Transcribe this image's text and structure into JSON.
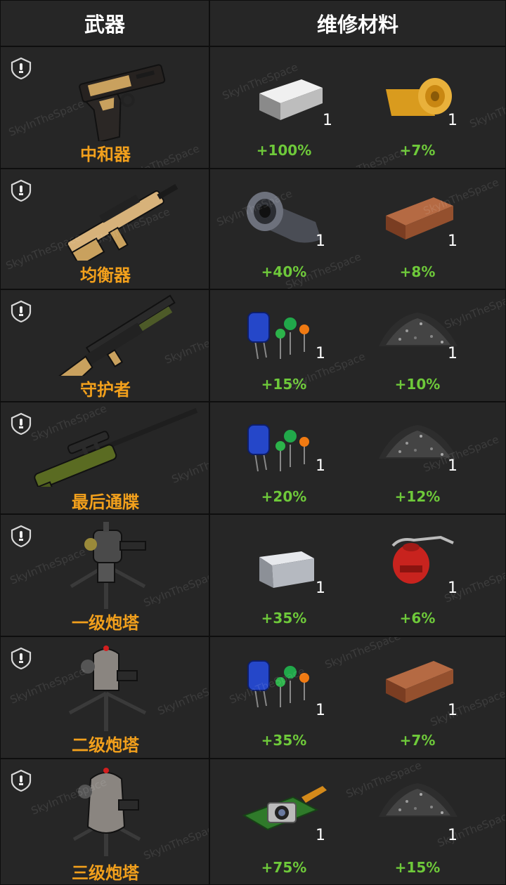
{
  "header": {
    "weapon_col": "武器",
    "materials_col": "维修材料"
  },
  "watermark": "SkyInTheSpace",
  "colors": {
    "weapon_name": "#f2a01c",
    "percent": "#6ec93a",
    "background": "#262626"
  },
  "rows": [
    {
      "weapon": {
        "name": "中和器",
        "icon": "pistol-icon"
      },
      "materials": [
        {
          "icon": "metal-ingot-icon",
          "qty": "1",
          "bonus": "+100%"
        },
        {
          "icon": "fabric-roll-icon",
          "qty": "1",
          "bonus": "+7%"
        }
      ]
    },
    {
      "weapon": {
        "name": "均衡器",
        "icon": "bullpup-rifle-icon"
      },
      "materials": [
        {
          "icon": "metal-sheet-roll-icon",
          "qty": "1",
          "bonus": "+40%"
        },
        {
          "icon": "wood-plank-icon",
          "qty": "1",
          "bonus": "+8%"
        }
      ]
    },
    {
      "weapon": {
        "name": "守护者",
        "icon": "shotgun-icon"
      },
      "materials": [
        {
          "icon": "electronic-components-icon",
          "qty": "1",
          "bonus": "+15%"
        },
        {
          "icon": "gunpowder-pile-icon",
          "qty": "1",
          "bonus": "+10%"
        }
      ]
    },
    {
      "weapon": {
        "name": "最后通牒",
        "icon": "sniper-rifle-icon"
      },
      "materials": [
        {
          "icon": "electronic-components-icon",
          "qty": "1",
          "bonus": "+20%"
        },
        {
          "icon": "gunpowder-pile-icon",
          "qty": "1",
          "bonus": "+12%"
        }
      ]
    },
    {
      "weapon": {
        "name": "一级炮塔",
        "icon": "turret-level-1-icon"
      },
      "materials": [
        {
          "icon": "steel-block-icon",
          "qty": "1",
          "bonus": "+35%"
        },
        {
          "icon": "oil-can-icon",
          "qty": "1",
          "bonus": "+6%"
        }
      ]
    },
    {
      "weapon": {
        "name": "二级炮塔",
        "icon": "turret-level-2-icon"
      },
      "materials": [
        {
          "icon": "electronic-components-icon",
          "qty": "1",
          "bonus": "+35%"
        },
        {
          "icon": "wood-plank-icon",
          "qty": "1",
          "bonus": "+7%"
        }
      ]
    },
    {
      "weapon": {
        "name": "三级炮塔",
        "icon": "turret-level-3-icon"
      },
      "materials": [
        {
          "icon": "camera-module-icon",
          "qty": "1",
          "bonus": "+75%"
        },
        {
          "icon": "gunpowder-pile-icon",
          "qty": "1",
          "bonus": "+15%"
        }
      ]
    }
  ]
}
